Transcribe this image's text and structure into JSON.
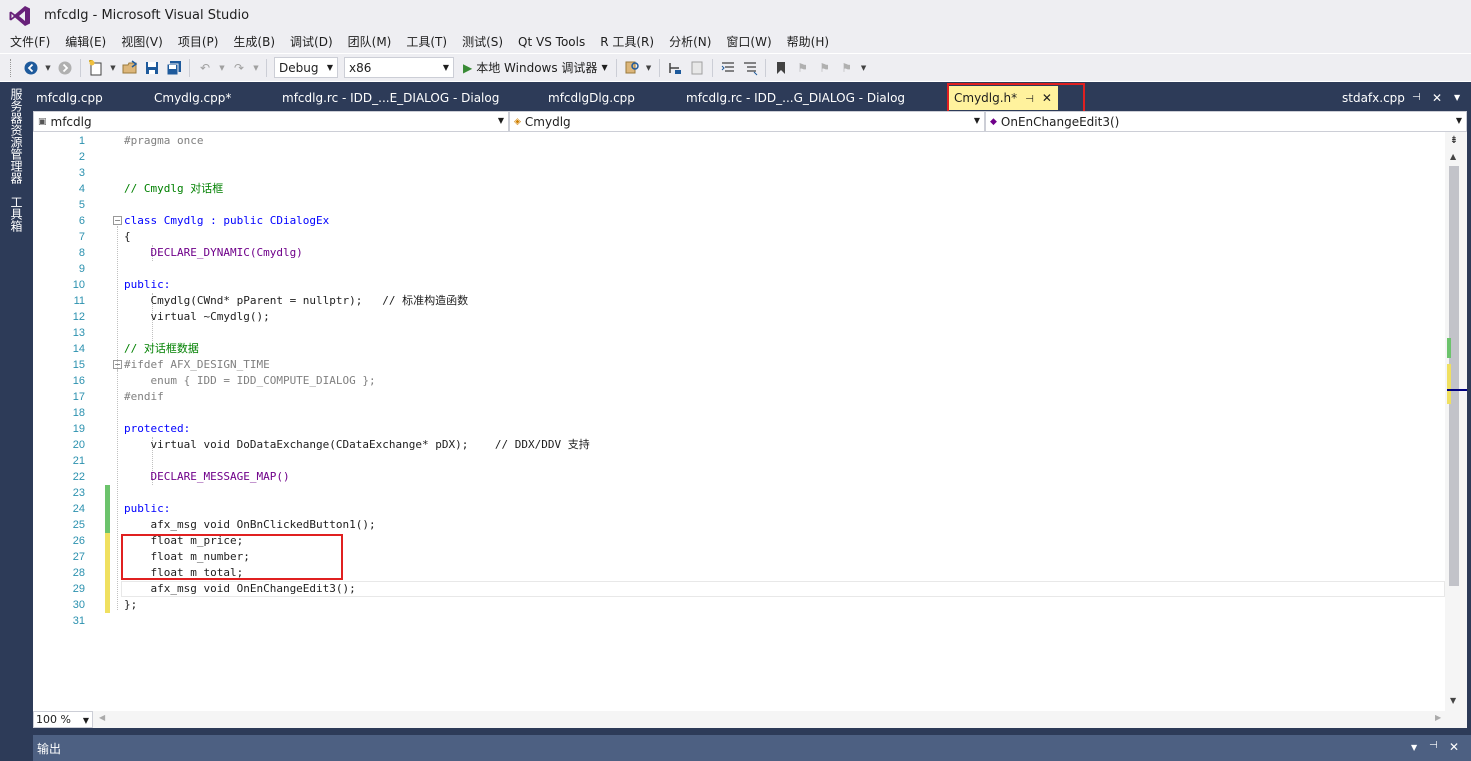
{
  "window": {
    "title": "mfcdlg - Microsoft Visual Studio"
  },
  "menu": [
    "文件(F)",
    "编辑(E)",
    "视图(V)",
    "项目(P)",
    "生成(B)",
    "调试(D)",
    "团队(M)",
    "工具(T)",
    "测试(S)",
    "Qt VS Tools",
    "R 工具(R)",
    "分析(N)",
    "窗口(W)",
    "帮助(H)"
  ],
  "toolbar": {
    "configuration": "Debug",
    "platform": "x86",
    "run_label": "本地 Windows 调试器"
  },
  "sidebar": {
    "server_explorer": "服务器资源管理器",
    "toolbox": "工具箱"
  },
  "tabs": [
    "mfcdlg.cpp",
    "Cmydlg.cpp*",
    "mfcdlg.rc - IDD_...E_DIALOG - Dialog",
    "mfcdlgDlg.cpp",
    "mfcdlg.rc - IDD_...G_DIALOG - Dialog",
    "Cmydlg.h*"
  ],
  "active_tab": "Cmydlg.h*",
  "pinned_tab": "stdafx.cpp",
  "navigation": {
    "project": "mfcdlg",
    "class": "Cmydlg",
    "member": "OnEnChangeEdit3()"
  },
  "code_lines": [
    "#pragma once",
    "",
    "",
    "// Cmydlg 对话框",
    "",
    "class Cmydlg : public CDialogEx",
    "{",
    "    DECLARE_DYNAMIC(Cmydlg)",
    "",
    "public:",
    "    Cmydlg(CWnd* pParent = nullptr);   // 标准构造函数",
    "    virtual ~Cmydlg();",
    "",
    "// 对话框数据",
    "#ifdef AFX_DESIGN_TIME",
    "    enum { IDD = IDD_COMPUTE_DIALOG };",
    "#endif",
    "",
    "protected:",
    "    virtual void DoDataExchange(CDataExchange* pDX);    // DDX/DDV 支持",
    "",
    "    DECLARE_MESSAGE_MAP()",
    "",
    "public:",
    "    afx_msg void OnBnClickedButton1();",
    "    float m_price;",
    "    float m_number;",
    "    float m_total;",
    "    afx_msg void OnEnChangeEdit3();",
    "};",
    ""
  ],
  "line_numbers": [
    "1",
    "2",
    "3",
    "4",
    "5",
    "6",
    "7",
    "8",
    "9",
    "10",
    "11",
    "12",
    "13",
    "14",
    "15",
    "16",
    "17",
    "18",
    "19",
    "20",
    "21",
    "22",
    "23",
    "24",
    "25",
    "26",
    "27",
    "28",
    "29",
    "30",
    "31"
  ],
  "zoom": "100 %",
  "output_pane": {
    "title": "输出"
  },
  "colors": {
    "frame": "#2d3b58",
    "active_tab": "#fff29d",
    "highlight_box": "#e02020",
    "keyword": "#0000ff",
    "type": "#2b91af",
    "comment": "#008000",
    "macro": "#6f008a"
  }
}
